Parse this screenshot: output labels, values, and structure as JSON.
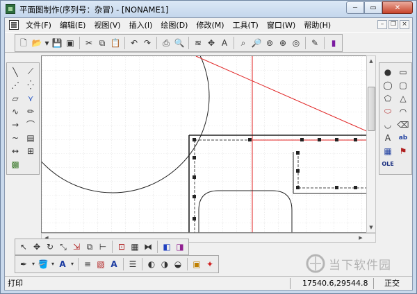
{
  "window": {
    "title": "平面图制作(序列号：杂冒) - [NONAME1]",
    "min_glyph": "─",
    "max_glyph": "▭",
    "close_glyph": "✕"
  },
  "menu": {
    "items": [
      "文件(F)",
      "编辑(E)",
      "视图(V)",
      "插入(I)",
      "绘图(D)",
      "修改(M)",
      "工具(T)",
      "窗口(W)",
      "帮助(H)"
    ],
    "mdi_min": "–",
    "mdi_restore": "❐",
    "mdi_close": "×"
  },
  "toolbar_main": {
    "buttons": [
      {
        "name": "new-doc-icon",
        "glyph": "🗋"
      },
      {
        "name": "open-folder-icon",
        "glyph": "📂"
      },
      {
        "name": "dropdown-arrow-icon",
        "glyph": "▾"
      },
      {
        "name": "save-icon",
        "glyph": "💾"
      },
      {
        "name": "save-all-icon",
        "glyph": "▣"
      },
      {
        "name": "cut-icon",
        "glyph": "✂"
      },
      {
        "name": "copy-icon",
        "glyph": "⧉"
      },
      {
        "name": "paste-icon",
        "glyph": "📋"
      },
      {
        "name": "undo-icon",
        "glyph": "↶"
      },
      {
        "name": "redo-icon",
        "glyph": "↷"
      },
      {
        "name": "print-icon",
        "glyph": "⎙"
      },
      {
        "name": "print-preview-icon",
        "glyph": "🔍"
      },
      {
        "name": "layers-icon",
        "glyph": "≋"
      },
      {
        "name": "snap-icon",
        "glyph": "✥"
      },
      {
        "name": "text-style-icon",
        "glyph": "A"
      },
      {
        "name": "zoom-window-icon",
        "glyph": "⌕"
      },
      {
        "name": "zoom-realtime-icon",
        "glyph": "🔎"
      },
      {
        "name": "zoom-extents-icon",
        "glyph": "⊚"
      },
      {
        "name": "zoom-center-icon",
        "glyph": "⊕"
      },
      {
        "name": "zoom-all-icon",
        "glyph": "◎"
      },
      {
        "name": "measure-icon",
        "glyph": "✎"
      },
      {
        "name": "color-fill-icon",
        "glyph": "▮"
      }
    ]
  },
  "toolbox_left": {
    "buttons": [
      {
        "name": "line-icon",
        "glyph": "╲"
      },
      {
        "name": "polyline-icon",
        "glyph": "⟋"
      },
      {
        "name": "dotted-line-icon",
        "glyph": "⋰"
      },
      {
        "name": "point-icon",
        "glyph": "⁛"
      },
      {
        "name": "wall-icon",
        "glyph": "▱"
      },
      {
        "name": "zigzag-icon",
        "glyph": "⋎"
      },
      {
        "name": "curve-icon",
        "glyph": "∿"
      },
      {
        "name": "pencil-icon",
        "glyph": "✏"
      },
      {
        "name": "arrow-icon",
        "glyph": "→"
      },
      {
        "name": "arc-icon",
        "glyph": "⌒"
      },
      {
        "name": "spline-icon",
        "glyph": "~"
      },
      {
        "name": "hatch-icon",
        "glyph": "▤"
      },
      {
        "name": "dimension-icon",
        "glyph": "↔"
      },
      {
        "name": "block-icon",
        "glyph": "⊞"
      },
      {
        "name": "image-icon",
        "glyph": "▩"
      }
    ]
  },
  "toolbox_right": {
    "buttons": [
      {
        "name": "dot-icon",
        "glyph": "●"
      },
      {
        "name": "rectangle-icon",
        "glyph": "▭"
      },
      {
        "name": "circle-icon",
        "glyph": "◯"
      },
      {
        "name": "rounded-rect-icon",
        "glyph": "▢"
      },
      {
        "name": "pentagon-icon",
        "glyph": "⬠"
      },
      {
        "name": "triangle-icon",
        "glyph": "△"
      },
      {
        "name": "ellipse-icon",
        "glyph": "⬭"
      },
      {
        "name": "half-circle-icon",
        "glyph": "◠"
      },
      {
        "name": "freehand-icon",
        "glyph": "◡"
      },
      {
        "name": "eraser-icon",
        "glyph": "⌫"
      },
      {
        "name": "text-icon",
        "glyph": "A"
      },
      {
        "name": "text-box-icon",
        "glyph": "ab"
      },
      {
        "name": "table-icon",
        "glyph": "▦"
      },
      {
        "name": "symbol-icon",
        "glyph": "⚑"
      },
      {
        "name": "ole-object-icon",
        "glyph": "OLE"
      }
    ]
  },
  "toolbar_edit": {
    "buttons": [
      {
        "name": "select-icon",
        "glyph": "↖"
      },
      {
        "name": "move-icon",
        "glyph": "✥"
      },
      {
        "name": "rotate-icon",
        "glyph": "↻"
      },
      {
        "name": "scale-icon",
        "glyph": "⤡"
      },
      {
        "name": "stretch-icon",
        "glyph": "⇲"
      },
      {
        "name": "copy-object-icon",
        "glyph": "⧉"
      },
      {
        "name": "measure-distance-icon",
        "glyph": "⊢"
      },
      {
        "name": "group-icon",
        "glyph": "⊡"
      },
      {
        "name": "array-icon",
        "glyph": "▦"
      },
      {
        "name": "mirror-icon",
        "glyph": "⧓"
      },
      {
        "name": "bring-front-icon",
        "glyph": "◧"
      },
      {
        "name": "send-back-icon",
        "glyph": "◨"
      }
    ]
  },
  "toolbar_style": {
    "buttons": [
      {
        "name": "pen-color-icon",
        "glyph": "✒"
      },
      {
        "name": "fill-color-icon",
        "glyph": "🪣"
      },
      {
        "name": "font-color-icon",
        "glyph": "A"
      },
      {
        "name": "line-weight-icon",
        "glyph": "≡"
      },
      {
        "name": "hatch-pattern-icon",
        "glyph": "▧"
      },
      {
        "name": "text-bold-icon",
        "glyph": "A"
      },
      {
        "name": "line-style-icon",
        "glyph": "☰"
      },
      {
        "name": "align-left-icon",
        "glyph": "◐"
      },
      {
        "name": "align-center-icon",
        "glyph": "◑"
      },
      {
        "name": "align-right-icon",
        "glyph": "◒"
      },
      {
        "name": "highlight-icon",
        "glyph": "▣"
      },
      {
        "name": "magic-icon",
        "glyph": "✦"
      }
    ]
  },
  "status": {
    "left": "打印",
    "coords": "17540.6,29544.8",
    "mode": "正交"
  },
  "watermark": {
    "text": "当下软件园",
    "color": "#a9a9a9"
  },
  "colors": {
    "accent_red": "#e02020",
    "grid": "#c8c8c8"
  }
}
